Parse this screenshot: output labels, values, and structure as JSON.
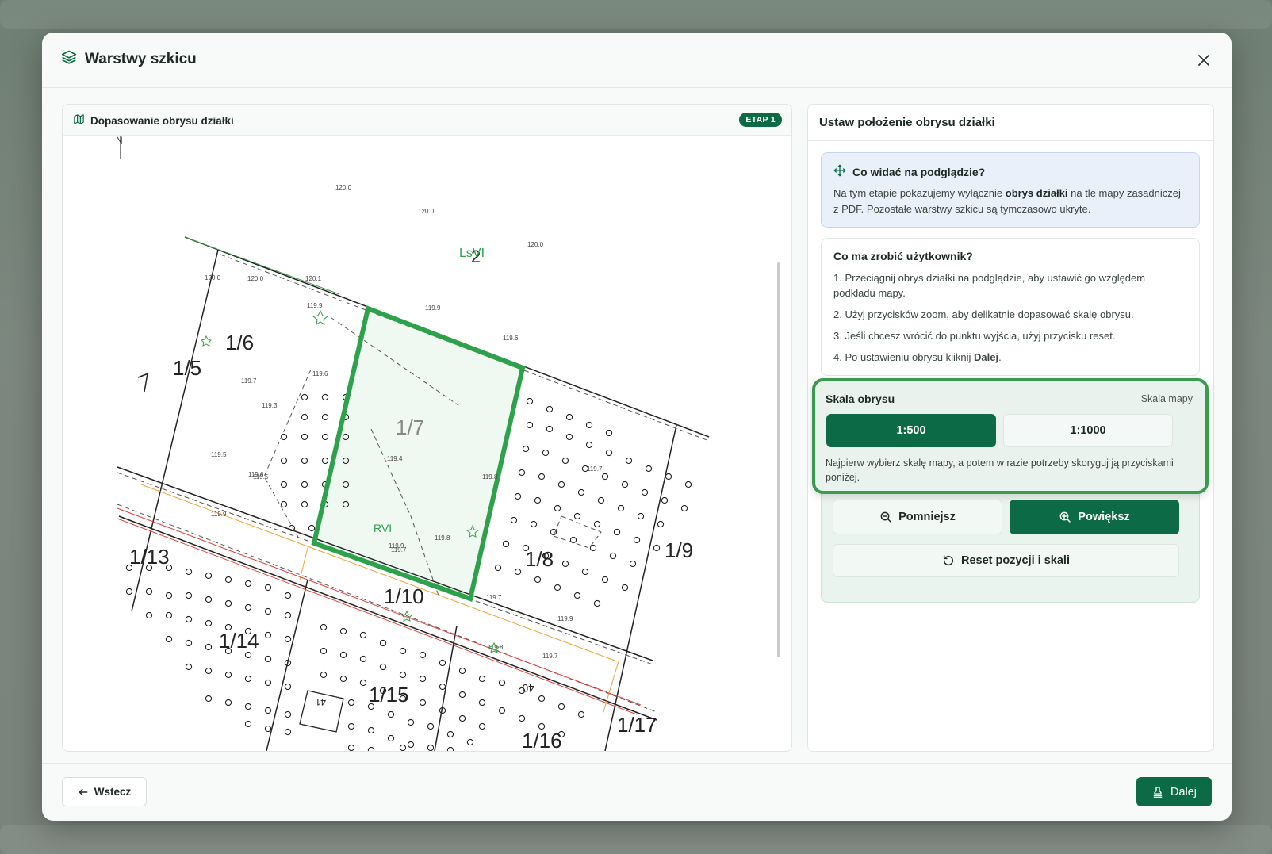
{
  "modal": {
    "title": "Warstwy szkicu",
    "close_label": "×"
  },
  "map_panel": {
    "title": "Dopasowanie obrysu działki",
    "stage_badge": "ETAP 1",
    "map_labels": {
      "north": "N",
      "plots": [
        "1/5",
        "1/6",
        "1/7",
        "1/8",
        "1/9",
        "1/10",
        "1/13",
        "1/14",
        "1/15",
        "1/16",
        "1/17"
      ],
      "land_use": [
        "LsVI",
        "RVI"
      ],
      "heights": [
        "120.0",
        "120.0",
        "120.0",
        "120.1",
        "120.0",
        "120.0",
        "119.9",
        "119.9",
        "119.6",
        "119.6",
        "119.7",
        "119.3",
        "119.7",
        "119.5",
        "119.6",
        "119.4",
        "119.5",
        "119.9",
        "119.8",
        "119.8",
        "119.9",
        "119.7",
        "119.7",
        "119.9",
        "119.8",
        "119.7"
      ],
      "parcel_2": "2",
      "building_41": "41",
      "building_40": "40"
    }
  },
  "side_panel": {
    "title": "Ustaw położenie obrysu działki",
    "info": {
      "title": "Co widać na podglądzie?",
      "text_before": "Na tym etapie pokazujemy wyłącznie ",
      "text_bold": "obrys działki",
      "text_after": " na tle mapy zasadniczej z PDF. Pozostałe warstwy szkicu są tymczasowo ukryte."
    },
    "steps": {
      "title": "Co ma zrobić użytkownik?",
      "items": [
        "1. Przeciągnij obrys działki na podglądzie, aby ustawić go względem podkładu mapy.",
        "2. Użyj przycisków zoom, aby delikatnie dopasować skalę obrysu.",
        "3. Jeśli chcesz wrócić do punktu wyjścia, użyj przycisku reset."
      ],
      "last_before": "4. Po ustawieniu obrysu kliknij ",
      "last_bold": "Dalej",
      "last_after": "."
    },
    "scale": {
      "title": "Skala obrysu",
      "map_scale_label": "Skala mapy",
      "option_1": "1:500",
      "option_2": "1:1000",
      "selected": "1:500",
      "hint": "Najpierw wybierz skalę mapy, a potem w razie potrzeby skoryguj ją przyciskami poniżej."
    },
    "zoom_out_label": "Pomniejsz",
    "zoom_in_label": "Powiększ",
    "reset_label": "Reset pozycji i skali"
  },
  "footer": {
    "back_label": "Wstecz",
    "next_label": "Dalej"
  },
  "colors": {
    "primary": "#0d6a47",
    "outline": "#2ea24b",
    "highlight_border": "#3a9a4e",
    "map_red": "#e0413a",
    "map_orange": "#f0a033",
    "map_green": "#3aa04a"
  }
}
